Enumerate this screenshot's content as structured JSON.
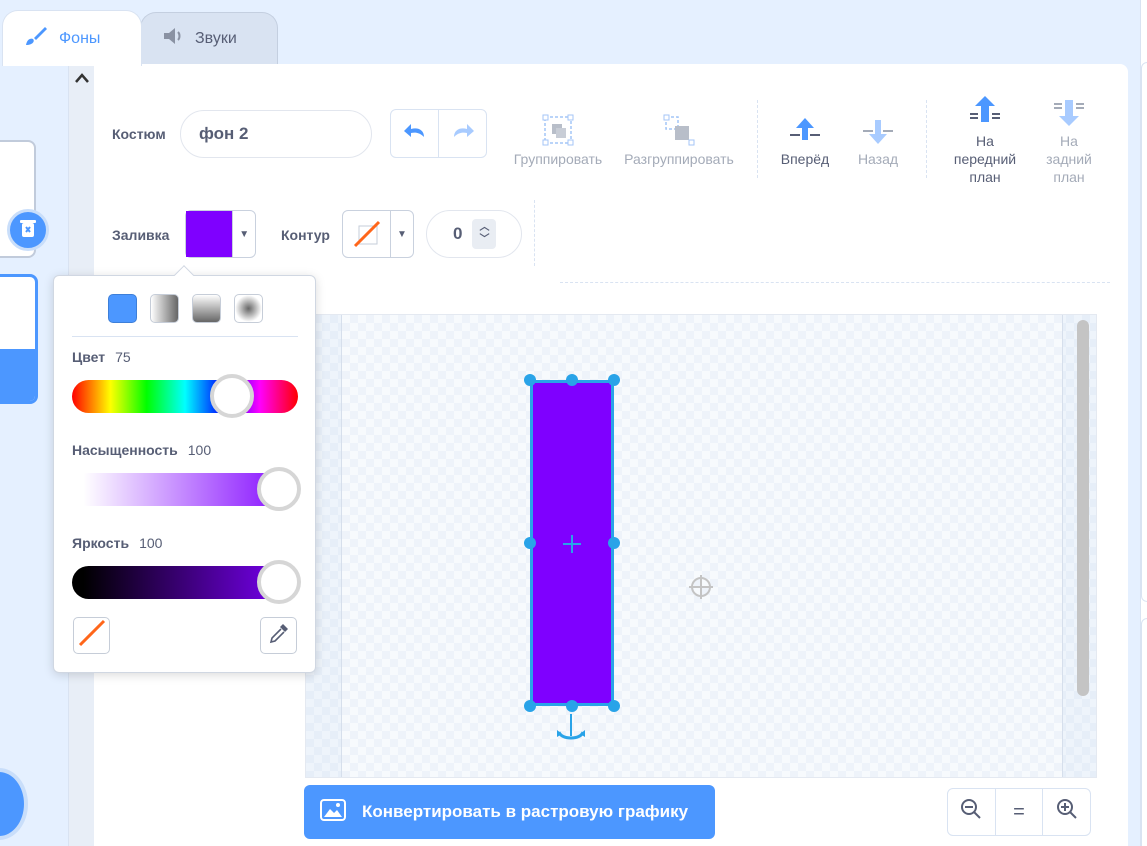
{
  "tabs": [
    {
      "label": "Фоны",
      "icon": "paintbrush-icon",
      "active": true
    },
    {
      "label": "Звуки",
      "icon": "speaker-icon",
      "active": false
    }
  ],
  "editor": {
    "costume_label": "Костюм",
    "costume_name": "фон 2",
    "fill_label": "Заливка",
    "outline_label": "Контур",
    "outline_width": "0",
    "fill_color": "#7f00ff",
    "outline_color": "none"
  },
  "toolbar": {
    "group": "Группировать",
    "ungroup": "Разгруппировать",
    "forward": "Вперёд",
    "backward": "Назад",
    "front": "На передний план",
    "back": "На задний план"
  },
  "convert_button": "Конвертировать в растровую графику",
  "zoom": {
    "out": "zoom-out-icon",
    "reset": "=",
    "in": "zoom-in-icon"
  },
  "color_picker": {
    "hue_label": "Цвет",
    "hue_value": "75",
    "saturation_label": "Насыщенность",
    "saturation_value": "100",
    "brightness_label": "Яркость",
    "brightness_value": "100",
    "fill_modes": [
      "solid",
      "horizontal-gradient",
      "vertical-gradient",
      "radial-gradient"
    ],
    "selected_mode": "solid"
  },
  "colors": {
    "accent": "#4c97ff",
    "selection": "#29a3e8",
    "shape_fill": "#7f00ff"
  }
}
